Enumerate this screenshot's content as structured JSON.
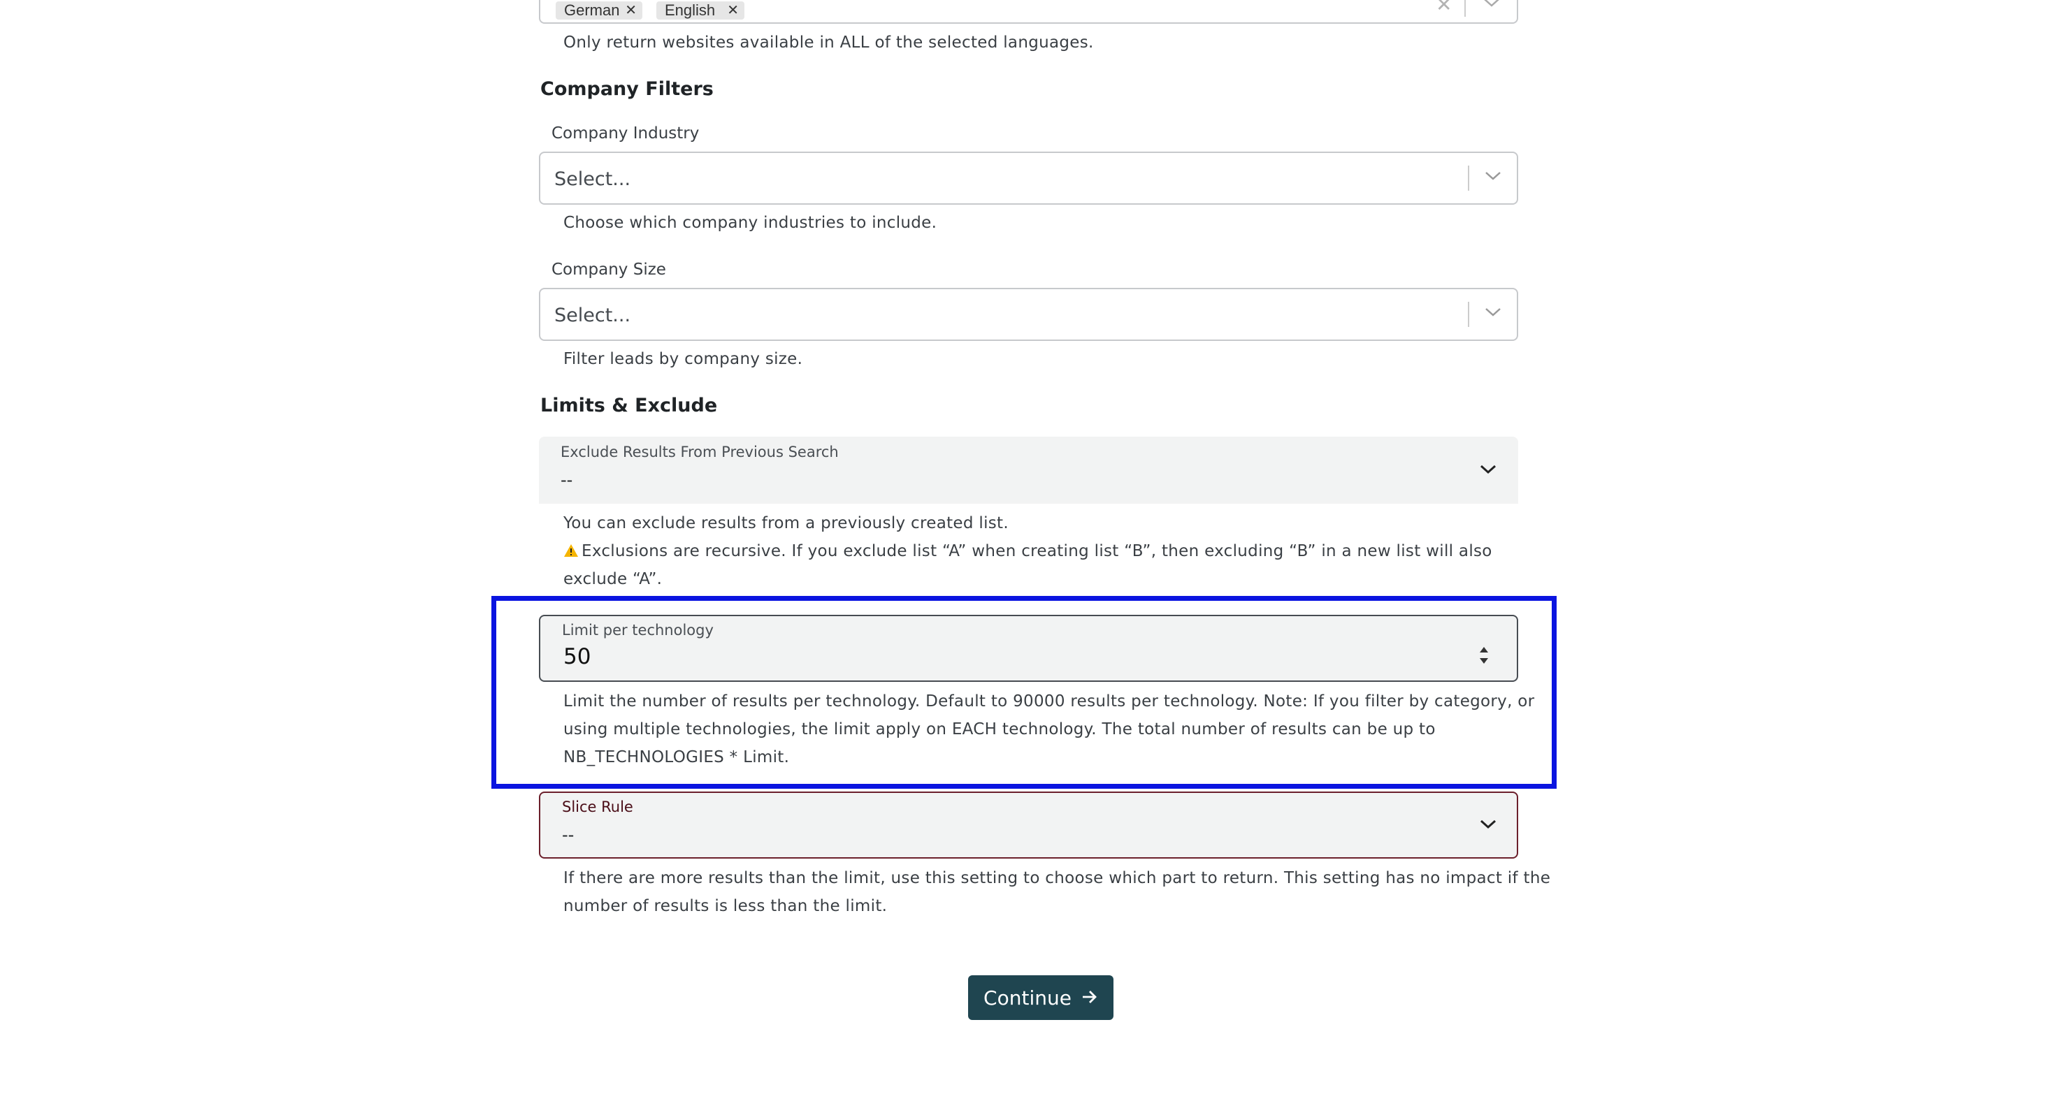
{
  "languages": {
    "chips": [
      {
        "label": "German"
      },
      {
        "label": "English"
      }
    ],
    "help": "Only return websites available in ALL of the selected languages."
  },
  "company_filters": {
    "title": "Company Filters",
    "industry": {
      "label": "Company Industry",
      "placeholder": "Select...",
      "help": "Choose which company industries to include."
    },
    "size": {
      "label": "Company Size",
      "placeholder": "Select...",
      "help": "Filter leads by company size."
    }
  },
  "limits": {
    "title": "Limits & Exclude",
    "exclude": {
      "label": "Exclude Results From Previous Search",
      "value": "--",
      "help1": "You can exclude results from a previously created list.",
      "help2_line1": "Exclusions are recursive. If you exclude list “A” when creating list “B”, then excluding “B” in a new list will also",
      "help2_line2": "exclude “A”."
    },
    "limit_per_technology": {
      "label": "Limit per technology",
      "value": "50",
      "help_line1": "Limit the number of results per technology. Default to 90000 results per technology. Note: If you filter by category, or",
      "help_line2": "using multiple technologies, the limit apply on EACH technology. The total number of results can be up to",
      "help_line3": "NB_TECHNOLOGIES * Limit."
    },
    "slice_rule": {
      "label": "Slice Rule",
      "value": "--",
      "help_line1": "If there are more results than the limit, use this setting to choose which part to return. This setting has no impact if the",
      "help_line2": "number of results is less than the limit."
    }
  },
  "actions": {
    "continue_label": "Continue"
  },
  "colors": {
    "highlight": "#0a14e0",
    "button_bg": "#1f4550",
    "slice_border": "#6b1f2b"
  },
  "icons": {
    "remove_chip": "close-icon",
    "clear": "clear-icon",
    "dropdown": "chevron-down-icon",
    "warning": "warning-icon",
    "spinner": "spinner-arrows-icon",
    "continue": "arrow-right-icon"
  }
}
